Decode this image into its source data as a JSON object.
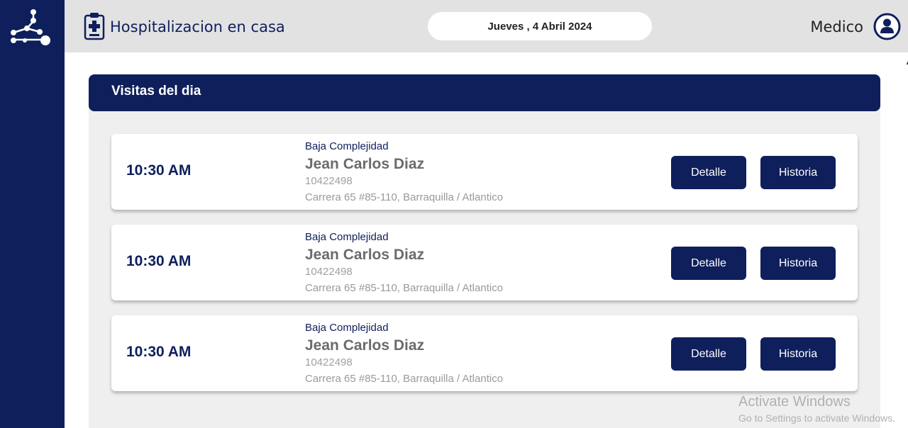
{
  "header": {
    "app_title": "Hospitalizacion en casa",
    "date": "Jueves , 4 Abril 2024",
    "role": "Medico"
  },
  "panel": {
    "title": "Visitas del dia"
  },
  "visits": [
    {
      "time": "10:30 AM",
      "complexity": "Baja Complejidad",
      "name": "Jean Carlos Diaz",
      "id": "10422498",
      "address": "Carrera 65 #85-110, Barraquilla / Atlantico",
      "detail_label": "Detalle",
      "history_label": "Historia"
    },
    {
      "time": "10:30 AM",
      "complexity": "Baja Complejidad",
      "name": "Jean Carlos Diaz",
      "id": "10422498",
      "address": "Carrera 65 #85-110, Barraquilla / Atlantico",
      "detail_label": "Detalle",
      "history_label": "Historia"
    },
    {
      "time": "10:30 AM",
      "complexity": "Baja Complejidad",
      "name": "Jean Carlos Diaz",
      "id": "10422498",
      "address": "Carrera 65 #85-110, Barraquilla / Atlantico",
      "detail_label": "Detalle",
      "history_label": "Historia"
    }
  ],
  "watermark": {
    "title": "Activate Windows",
    "subtitle": "Go to Settings to activate Windows."
  },
  "colors": {
    "brand_navy": "#0f1f5c",
    "topbar_bg": "#e2e2e2",
    "panel_bg": "#efefef"
  },
  "icons": {
    "logo": "network-nodes-logo",
    "app": "clipboard-medical-icon",
    "user": "user-circle-icon"
  }
}
